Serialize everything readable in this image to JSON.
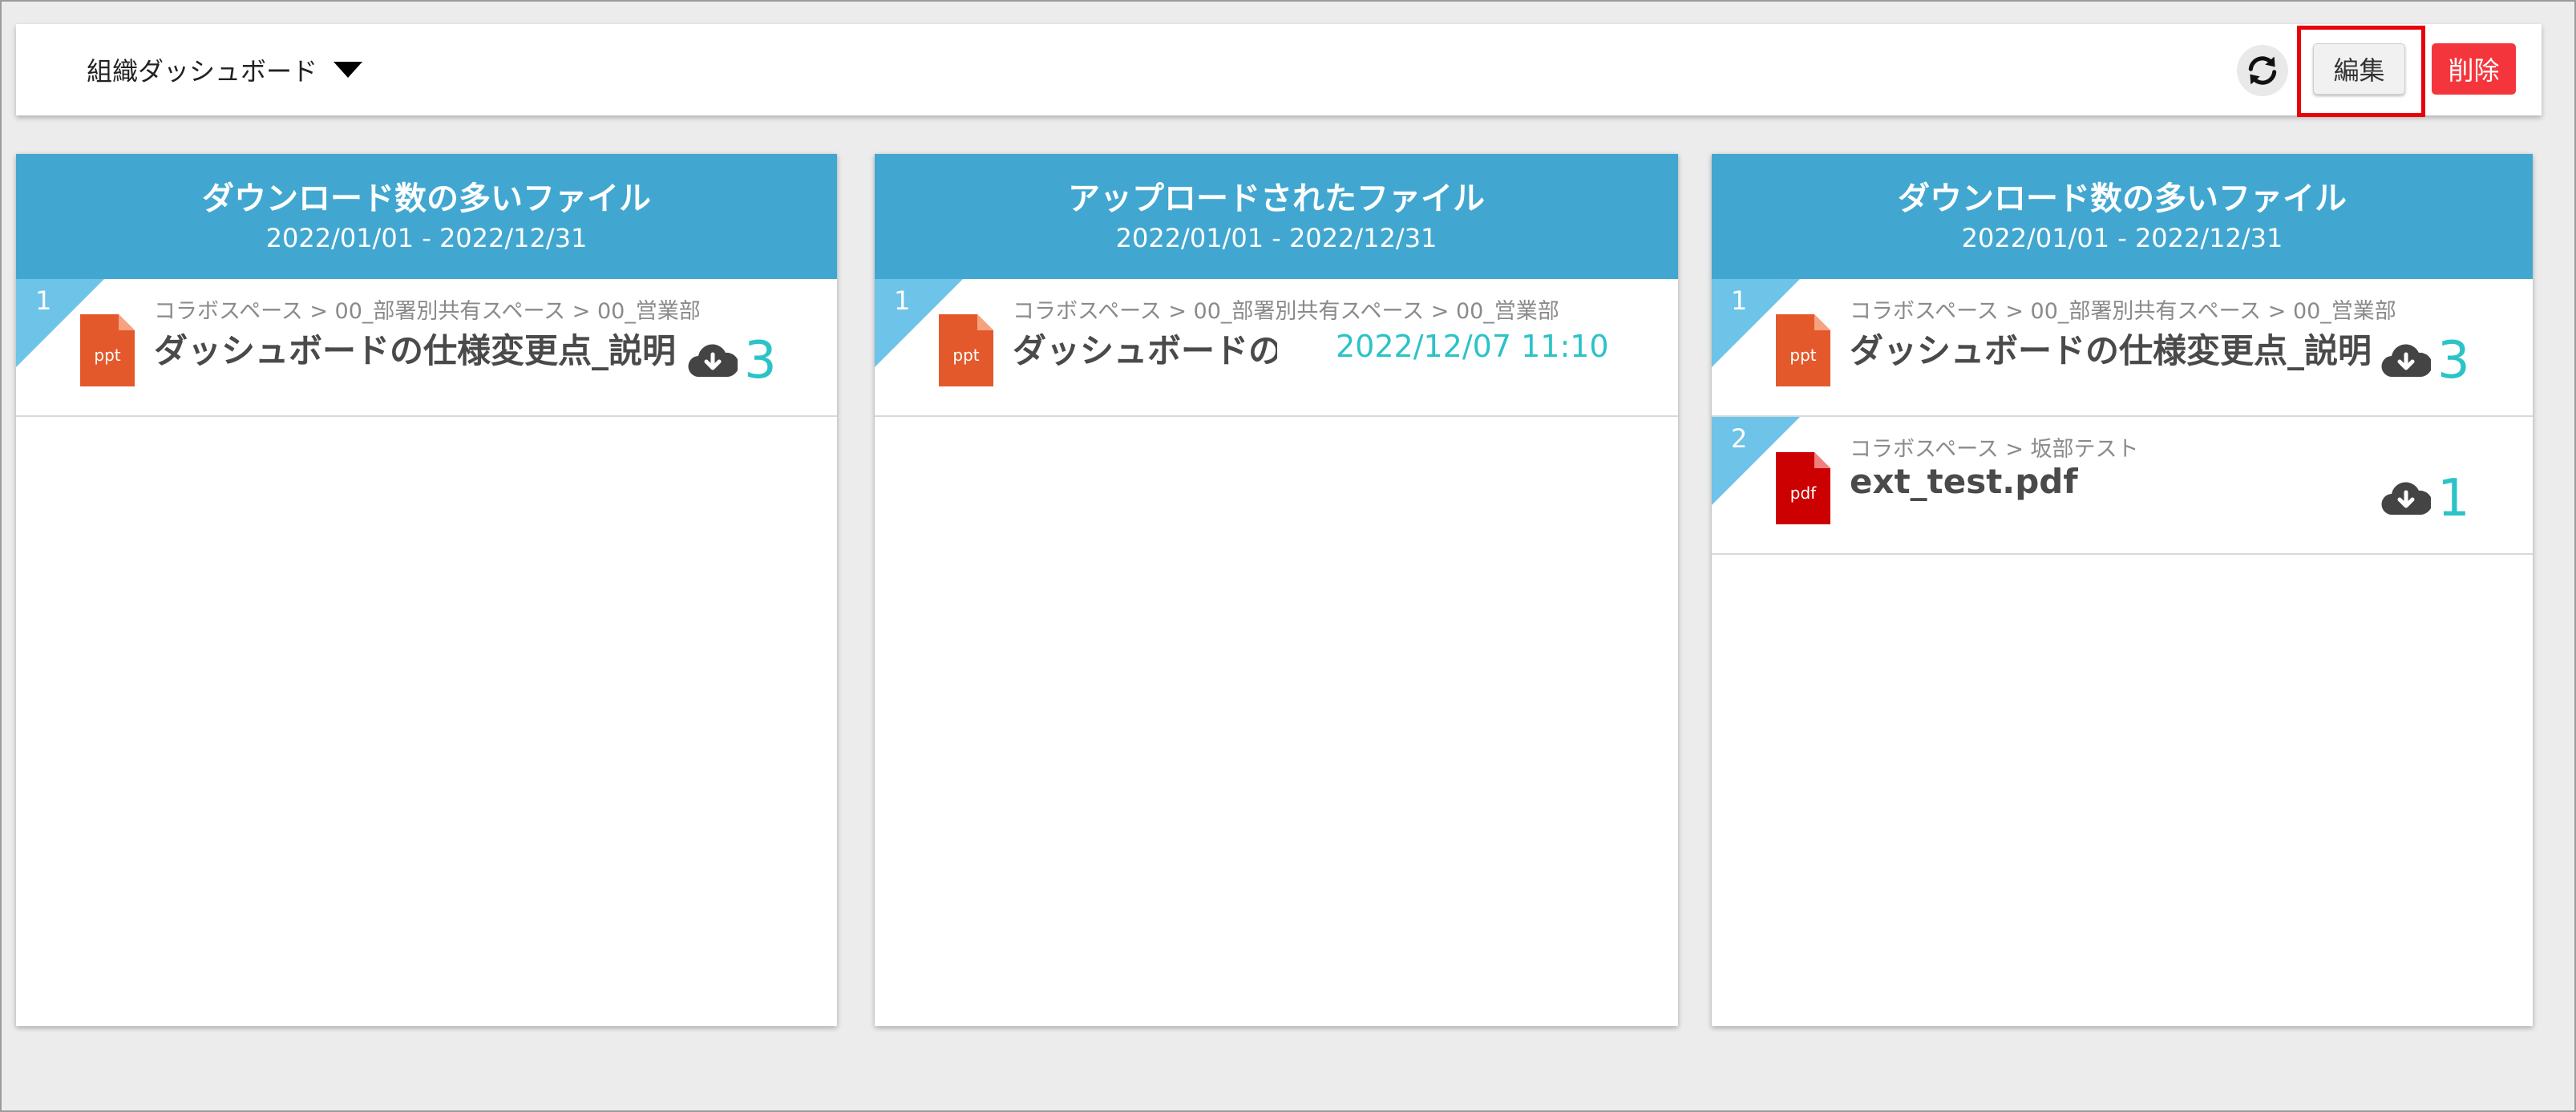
{
  "header": {
    "dashboard_name": "組織ダッシュボード",
    "edit_label": "編集",
    "delete_label": "削除"
  },
  "widgets": [
    {
      "title": "ダウンロード数の多いファイル",
      "range": "2022/01/01 - 2022/12/31",
      "items": [
        {
          "rank": "1",
          "path": "コラボスペース > 00_部署別共有スペース > 00_営業部",
          "name": "ダッシュボードの仕様変更点_説明",
          "type": "ppt",
          "count": "3"
        }
      ]
    },
    {
      "title": "アップロードされたファイル",
      "range": "2022/01/01 - 2022/12/31",
      "items": [
        {
          "rank": "1",
          "path": "コラボスペース > 00_部署別共有スペース > 00_営業部",
          "name": "ダッシュボードの",
          "type": "ppt",
          "date": "2022/12/07 11:10"
        }
      ]
    },
    {
      "title": "ダウンロード数の多いファイル",
      "range": "2022/01/01 - 2022/12/31",
      "items": [
        {
          "rank": "1",
          "path": "コラボスペース > 00_部署別共有スペース > 00_営業部",
          "name": "ダッシュボードの仕様変更点_説明",
          "type": "ppt",
          "count": "3"
        },
        {
          "rank": "2",
          "path": "コラボスペース > 坂部テスト",
          "name": "ext_test.pdf",
          "type": "pdf",
          "count": "1"
        }
      ]
    }
  ],
  "colors": {
    "header_blue": "#41a7d1",
    "rank_blue": "#6ec3e8",
    "count_teal": "#2bc3c8",
    "ppt_orange": "#e4592b",
    "pdf_red": "#cc0000",
    "delete_red": "#f4363c",
    "highlight_red": "#e8000b"
  },
  "icons": {
    "refresh": "refresh-icon",
    "download": "cloud-download-icon",
    "ppt": "ppt-file-icon",
    "pdf": "pdf-file-icon",
    "dropdown": "caret-down-icon"
  }
}
